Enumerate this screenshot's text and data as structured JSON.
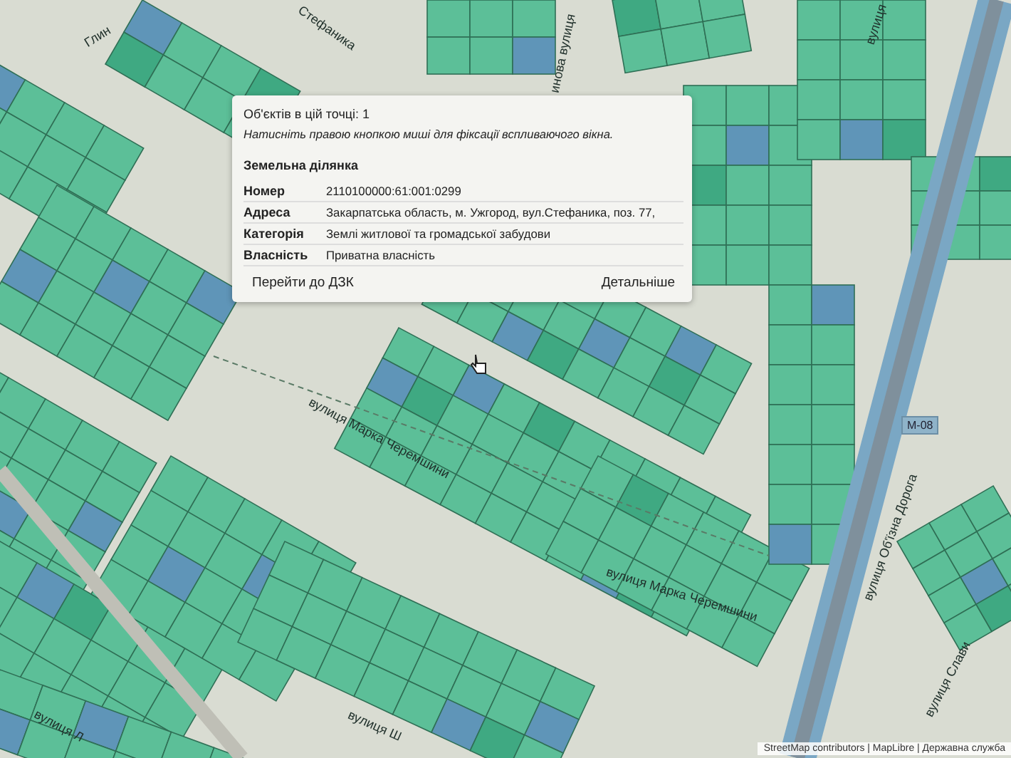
{
  "map": {
    "street_labels": [
      {
        "text": "Глин"
      },
      {
        "text": "Стефаника"
      },
      {
        "text": "инова вулиця"
      },
      {
        "text": "вулиця"
      },
      {
        "text": "вулиця Марка Черемшини"
      },
      {
        "text": "вулиця Марка Черемшини"
      },
      {
        "text": "вулиця Об'їзна Дорога"
      },
      {
        "text": "вулиця Слави"
      },
      {
        "text": "вулиця Л"
      },
      {
        "text": "вулиця Ш"
      }
    ],
    "road_badge": "М-08",
    "attribution": "StreetMap contributors | MapLibre | Державна служба"
  },
  "popup": {
    "count_text": "Об'єктів в цій точці: 1",
    "hint": "Натисніть правою кнопкою миші для фіксації вспливаючого вікна.",
    "section_title": "Земельна ділянка",
    "rows": [
      {
        "label": "Номер",
        "value": "2110100000:61:001:0299"
      },
      {
        "label": "Адреса",
        "value": "Закарпатська область, м. Ужгород, вул.Стефаника, поз. 77,"
      },
      {
        "label": "Категорія",
        "value": "Землі житлової та громадської забудови"
      },
      {
        "label": "Власність",
        "value": "Приватна власність"
      }
    ],
    "buttons": [
      {
        "label": "Перейти до ДЗК"
      },
      {
        "label": "Детальніше"
      }
    ]
  }
}
